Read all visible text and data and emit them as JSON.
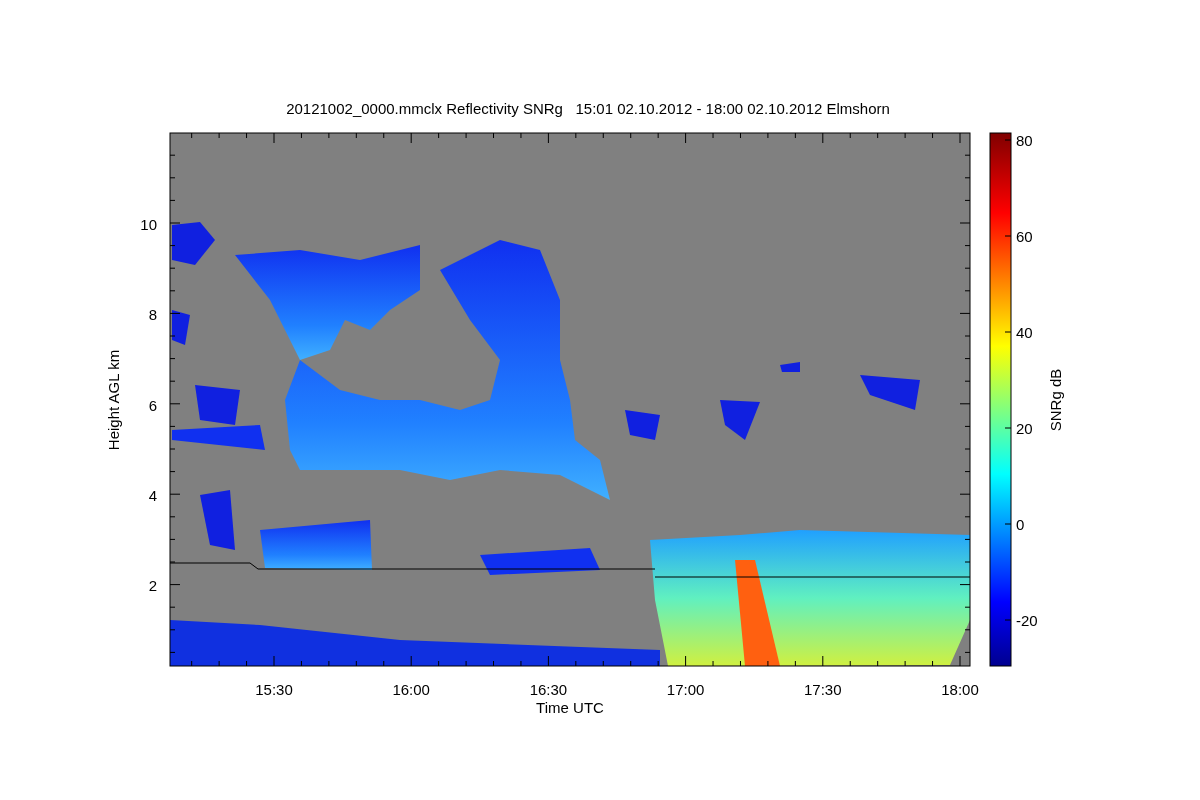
{
  "title": "20121002_0000.mmclx Reflectivity SNRg   15:01 02.10.2012 - 18:00 02.10.2012 Elmshorn",
  "y_axis": {
    "label": "Height AGL km",
    "ticks": [
      "10",
      "8",
      "6",
      "4",
      "2"
    ]
  },
  "x_axis": {
    "label": "Time UTC",
    "ticks": [
      "15:30",
      "16:00",
      "16:30",
      "17:00",
      "17:30",
      "18:00"
    ]
  },
  "colorbar": {
    "label": "SNRg dB",
    "ticks": [
      "80",
      "60",
      "40",
      "20",
      "0",
      "-20"
    ]
  }
}
